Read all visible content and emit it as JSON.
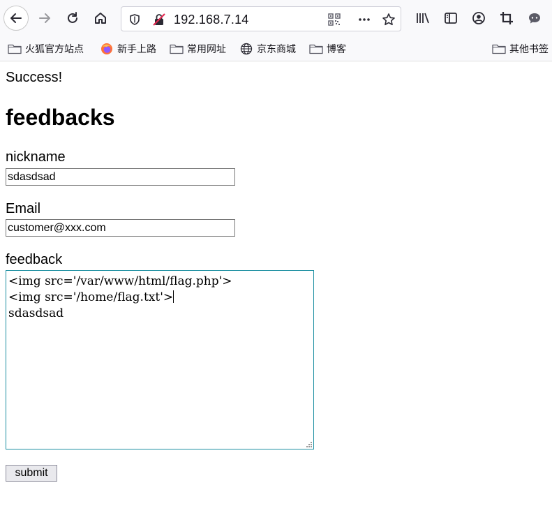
{
  "browser": {
    "url": "192.168.7.14",
    "bookmarks": [
      {
        "label": "火狐官方站点",
        "icon": "folder-icon"
      },
      {
        "label": "新手上路",
        "icon": "firefox-icon"
      },
      {
        "label": "常用网址",
        "icon": "folder-icon"
      },
      {
        "label": "京东商城",
        "icon": "globe-icon"
      },
      {
        "label": "博客",
        "icon": "folder-icon"
      },
      {
        "label": "其他书签",
        "icon": "folder-icon"
      }
    ]
  },
  "page": {
    "status": "Success!",
    "heading": "feedbacks",
    "nickname_label": "nickname",
    "nickname_value": "sdasdsad",
    "email_label": "Email",
    "email_value": "customer@xxx.com",
    "feedback_label": "feedback",
    "feedback_lines": [
      "<img src='/var/www/html/flag.php'>",
      "<img src='/home/flag.txt'>",
      "sdasdsad"
    ],
    "submit_label": "submit"
  }
}
